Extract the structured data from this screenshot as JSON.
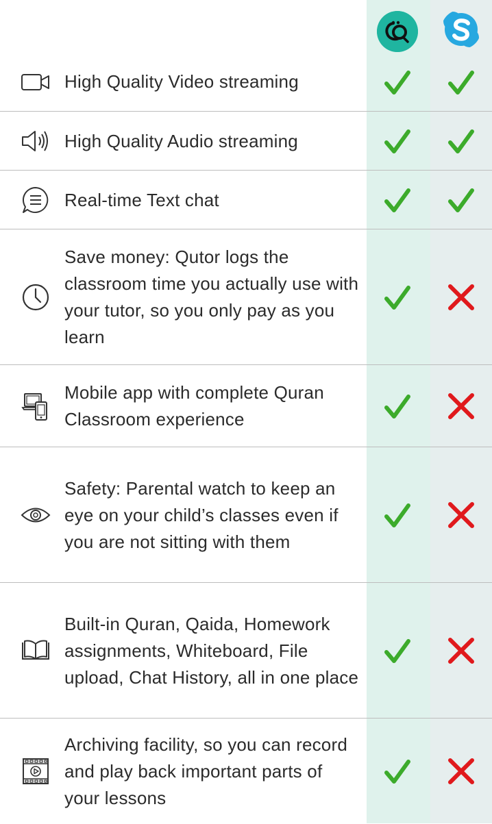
{
  "columns": [
    {
      "name": "Qutor",
      "logo_icon": "qutor-logo-icon",
      "color": "#1fb5a0"
    },
    {
      "name": "Skype",
      "logo_icon": "skype-logo-icon",
      "color": "#27a8e0"
    }
  ],
  "colors": {
    "check": "#3cab2b",
    "cross": "#e0191c",
    "qutor_column": "#dff2ec",
    "skype_column": "#e6eeee"
  },
  "features": [
    {
      "icon": "video-camera-icon",
      "label": "High Quality Video streaming",
      "qutor": "check",
      "skype": "check"
    },
    {
      "icon": "speaker-icon",
      "label": "High Quality Audio streaming",
      "qutor": "check",
      "skype": "check"
    },
    {
      "icon": "chat-bubble-icon",
      "label": "Real-time Text chat",
      "qutor": "check",
      "skype": "check"
    },
    {
      "icon": "clock-icon",
      "label": "Save money: Qutor logs the classroom time you actually use with your tutor, so you only pay as you learn",
      "qutor": "check",
      "skype": "cross"
    },
    {
      "icon": "devices-icon",
      "label": "Mobile app with complete Quran Classroom experience",
      "qutor": "check",
      "skype": "cross"
    },
    {
      "icon": "eye-icon",
      "label": "Safety: Parental watch to keep an eye on your child’s classes even if you are not sitting with them",
      "qutor": "check",
      "skype": "cross"
    },
    {
      "icon": "open-book-icon",
      "label": "Built-in Quran, Qaida, Homework assignments, Whiteboard, File upload, Chat History, all in one place",
      "qutor": "check",
      "skype": "cross"
    },
    {
      "icon": "film-play-icon",
      "label": "Archiving facility, so you can record and play back important parts of your lessons",
      "qutor": "check",
      "skype": "cross"
    }
  ]
}
